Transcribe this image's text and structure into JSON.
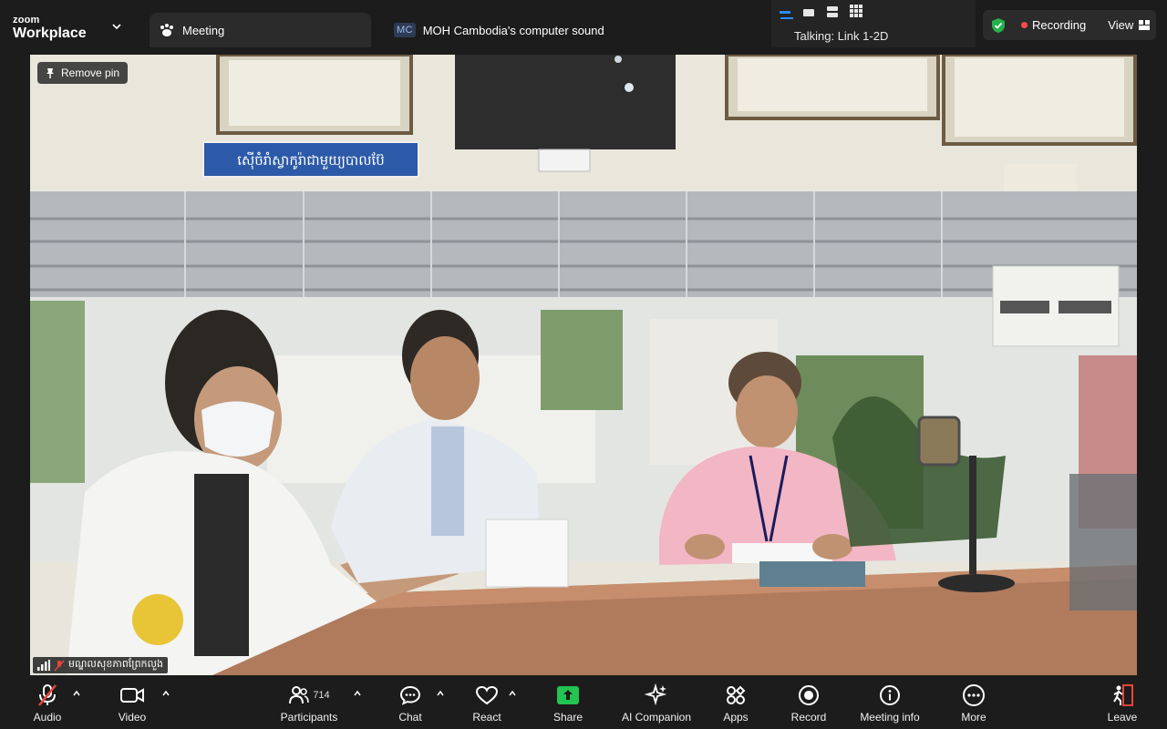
{
  "topbar": {
    "brand_small": "zoom",
    "brand_big": "Workplace",
    "meeting_tab": "Meeting",
    "share_badge": "MC",
    "share_label": "MOH Cambodia's computer sound",
    "talking": "Talking: Link 1-2D",
    "recording": "Recording",
    "view": "View"
  },
  "video": {
    "remove_pin": "Remove pin",
    "participant_name": "មណ្ឌលសុខភាពព្រែកលួង",
    "sign_text": "ស៊ើចំរាំស្វាកូរ៉ាជាមួយ្យបាលប៊ែ",
    "accent": "#2d5aa8"
  },
  "toolbar": {
    "audio": "Audio",
    "video": "Video",
    "participants": "Participants",
    "participants_count": "714",
    "chat": "Chat",
    "react": "React",
    "share": "Share",
    "ai_companion": "AI Companion",
    "apps": "Apps",
    "record": "Record",
    "meeting_info": "Meeting info",
    "more": "More",
    "leave": "Leave"
  },
  "colors": {
    "share_green": "#23c552",
    "recording_red": "#ff4b4b",
    "shield_green": "#24b24b",
    "leave_red": "#e8453c"
  }
}
